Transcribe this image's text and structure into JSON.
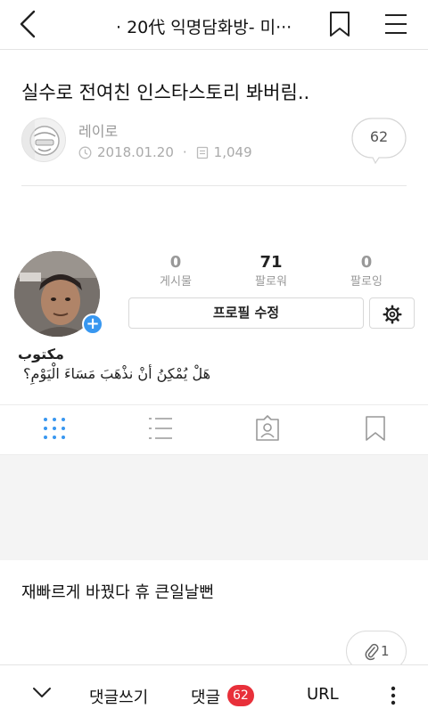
{
  "header": {
    "title": "· 20代 익명담화방- 미···",
    "icons": {
      "back": "chevron-left-icon",
      "bookmark": "bookmark-icon",
      "menu": "hamburger-menu-icon"
    }
  },
  "post": {
    "title": "실수로 전여친 인스타스토리 봐버림..",
    "author": "레이로",
    "date": "2018.01.20",
    "views": "1,049",
    "comment_count": "62",
    "body_text": "재빠르게 바꿨다 휴 큰일날뻔",
    "attachments": "1"
  },
  "screenshot": {
    "stats": [
      {
        "value": "0",
        "label": "게시물"
      },
      {
        "value": "71",
        "label": "팔로워"
      },
      {
        "value": "0",
        "label": "팔로잉"
      }
    ],
    "edit_profile_label": "프로필 수정",
    "profile_name": "مكتوب",
    "bio": "هَلْ يُمْكِنُ أنْ نذْهَبَ مَسَاءَ الْيَوْمِ؟",
    "tabs": [
      "grid-icon",
      "list-icon",
      "tagged-icon",
      "saved-icon"
    ],
    "accent_color": "#3897f0"
  },
  "bottom_bar": {
    "write_comment": "댓글쓰기",
    "comments": "댓글",
    "comments_count": "62",
    "url": "URL",
    "badge_color": "#e8303a"
  }
}
